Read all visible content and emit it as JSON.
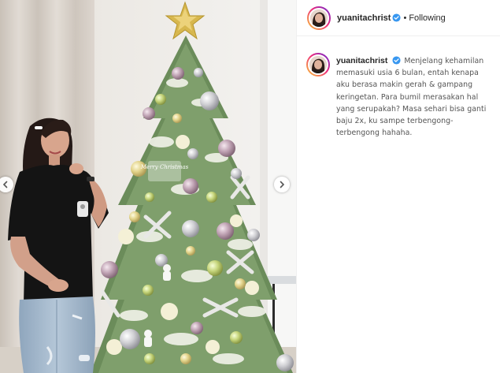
{
  "post": {
    "username": "yuanitachrist",
    "verified_icon": "verified-badge-icon",
    "separator": "•",
    "follow_status": "Following",
    "caption": {
      "username": "yuanitachrist",
      "text": "Menjelang kehamilan memasuki usia 6 bulan, entah kenapa aku berasa makin gerah & gampang keringetan. Para bumil merasakan hal yang serupakah? Masa sehari bisa ganti baju 2x, ku sampe terbengong-terbengong hahaha."
    }
  },
  "photo": {
    "ornament_text": "Merry Christmas"
  },
  "carousel": {
    "prev_icon": "chevron-left-icon",
    "next_icon": "chevron-right-icon"
  },
  "colors": {
    "text": "#262626",
    "secondary": "#555555",
    "verified_blue": "#3897f0",
    "divider": "#efefef"
  }
}
